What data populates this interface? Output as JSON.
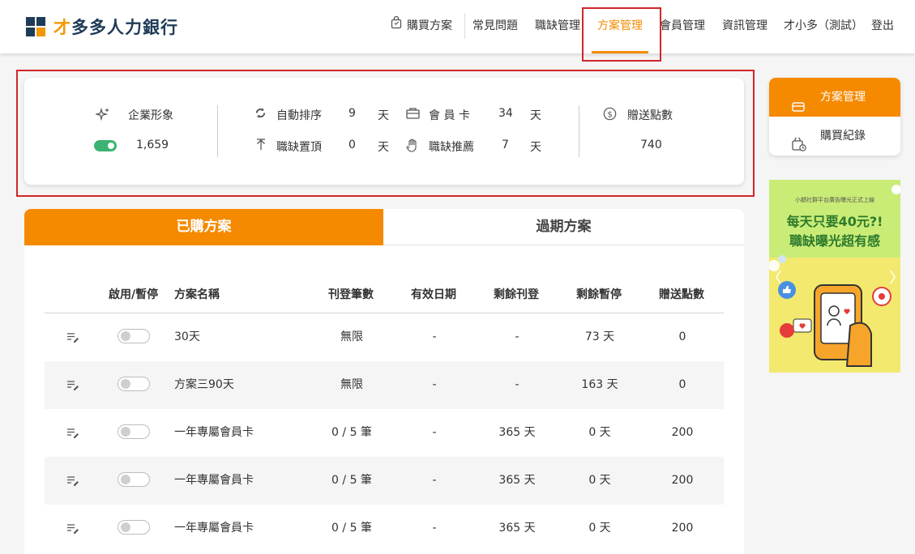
{
  "brand": {
    "accent": "#f08c00",
    "navy": "#1f3b57",
    "highlight_box": "#d0262a"
  },
  "header": {
    "logo_first": "才",
    "logo_rest": "多多人力銀行",
    "nav": {
      "buy_plan": "購買方案",
      "faq": "常見問題",
      "job_mgmt": "職缺管理",
      "plan_mgmt": "方案管理",
      "member_mgmt": "會員管理",
      "info_mgmt": "資訊管理",
      "user": "才小多（測試）",
      "logout": "登出"
    },
    "active_nav": "方案管理"
  },
  "stats": {
    "image_label": "企業形象",
    "image_toggle": "on",
    "image_value": "1,659",
    "auto_sort_label": "自動排序",
    "auto_sort_value": "9",
    "pin_label": "職缺置頂",
    "pin_value": "0",
    "member_card_label": "會 員 卡",
    "member_card_value": "34",
    "recommend_label": "職缺推薦",
    "recommend_value": "7",
    "unit": "天",
    "bonus_label": "贈送點數",
    "bonus_value": "740"
  },
  "sidebar": {
    "plan_mgmt": "方案管理",
    "purchase_record": "購買紀錄"
  },
  "ad": {
    "top_text": "小額社群平台廣告曝光正式上線",
    "line1": "每天只要40元?!",
    "line2": "職缺曝光超有感"
  },
  "tabs": {
    "purchased": "已購方案",
    "expired": "過期方案"
  },
  "table": {
    "headers": {
      "toggle": "啟用/暫停",
      "name": "方案名稱",
      "posts": "刊登筆數",
      "valid": "有效日期",
      "remain_post": "剩餘刊登",
      "remain_pause": "剩餘暫停",
      "bonus": "贈送點數"
    },
    "rows": [
      {
        "name": "30天",
        "posts": "無限",
        "valid": "-",
        "remain_post": "-",
        "remain_pause": "73 天",
        "bonus": "0"
      },
      {
        "name": "方案三90天",
        "posts": "無限",
        "valid": "-",
        "remain_post": "-",
        "remain_pause": "163 天",
        "bonus": "0"
      },
      {
        "name": "一年專屬會員卡",
        "posts": "0 / 5 筆",
        "valid": "-",
        "remain_post": "365 天",
        "remain_pause": "0 天",
        "bonus": "200"
      },
      {
        "name": "一年專屬會員卡",
        "posts": "0 / 5 筆",
        "valid": "-",
        "remain_post": "365 天",
        "remain_pause": "0 天",
        "bonus": "200"
      },
      {
        "name": "一年專屬會員卡",
        "posts": "0 / 5 筆",
        "valid": "-",
        "remain_post": "365 天",
        "remain_pause": "0 天",
        "bonus": "200"
      }
    ]
  }
}
